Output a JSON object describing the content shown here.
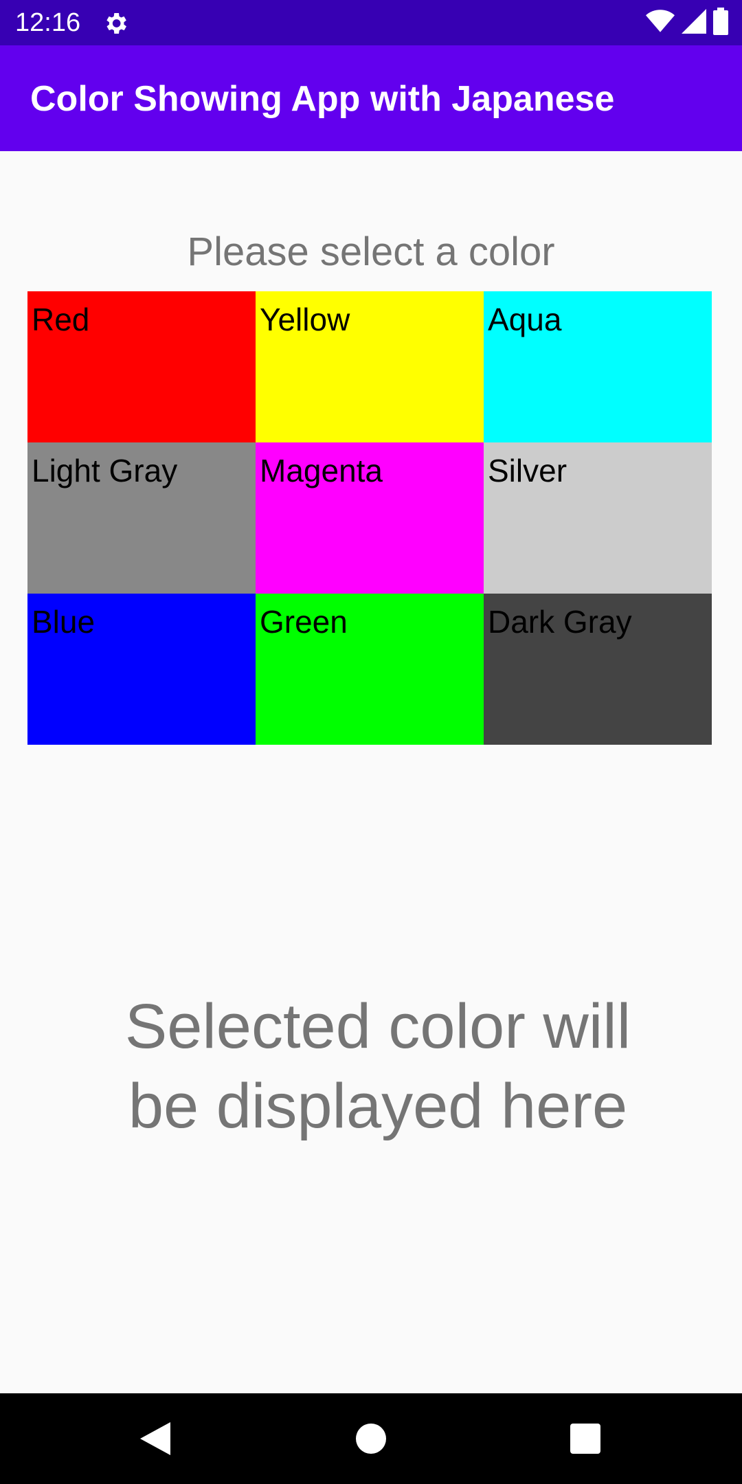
{
  "status_bar": {
    "time": "12:16",
    "icons": [
      "settings-icon",
      "wifi-icon",
      "cell-signal-icon",
      "battery-icon"
    ]
  },
  "app_bar": {
    "title": "Color Showing App with Japanese",
    "color": "#6200ee"
  },
  "prompt": "Please select a color",
  "colors": [
    {
      "label": "Red",
      "color": "#ff0000"
    },
    {
      "label": "Yellow",
      "color": "#ffff00"
    },
    {
      "label": "Aqua",
      "color": "#00ffff"
    },
    {
      "label": "Light Gray",
      "color": "#888888"
    },
    {
      "label": "Magenta",
      "color": "#ff00ff"
    },
    {
      "label": "Silver",
      "color": "#cccccc"
    },
    {
      "label": "Blue",
      "color": "#0000ff"
    },
    {
      "label": "Green",
      "color": "#00ff00"
    },
    {
      "label": "Dark Gray",
      "color": "#444444"
    }
  ],
  "result": {
    "line1": "Selected color will",
    "line2": "be displayed here"
  },
  "nav_bar": {
    "icons": [
      "back-icon",
      "home-icon",
      "recents-icon"
    ]
  }
}
